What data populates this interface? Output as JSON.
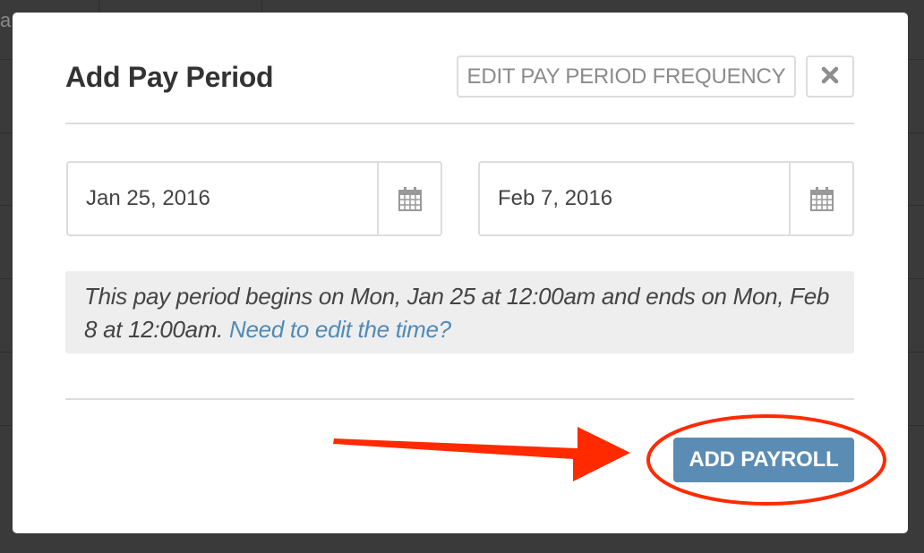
{
  "background": {
    "partial_text": "a"
  },
  "modal": {
    "title": "Add Pay Period",
    "edit_frequency_label": "EDIT PAY PERIOD FREQUENCY",
    "close_icon": "close-icon",
    "start_date": "Jan 25, 2016",
    "end_date": "Feb 7, 2016",
    "calendar_icon": "calendar-icon",
    "info": {
      "text": "This pay period begins on Mon, Jan 25 at 12:00am and ends on Mon, Feb 8 at 12:00am. ",
      "link": "Need to edit the time?"
    },
    "primary_button": "ADD PAYROLL"
  },
  "colors": {
    "primary": "#5b8cb4",
    "link": "#4f8ab7",
    "annotation": "#ff2a00",
    "border": "#dddddd",
    "info_bg": "#eeeeee"
  }
}
